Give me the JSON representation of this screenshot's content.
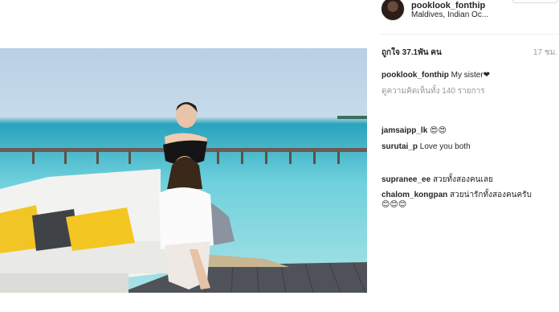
{
  "post": {
    "username": "pooklook_fonthip",
    "location": "Maldives, Indian Oc...",
    "likes": "ถูกใจ 37.1พัน คน",
    "time": "17 ชม.",
    "caption_user": "pooklook_fonthip",
    "caption_text": "My sister❤",
    "view_all": "ดูความคิดเห็นทั้ง 140 รายการ"
  },
  "comments": [
    {
      "user": "jamsaipp_lk",
      "text": "😍😍"
    },
    {
      "user": "surutai_p",
      "text": "Love you both"
    },
    {
      "user": "supranee_ee",
      "text": "สวยทั้งสองคนเลย"
    },
    {
      "user": "chalom_kongpan",
      "text": "สวยน่ารักทั้งสองคนครับ"
    },
    {
      "user": "",
      "text": "😊😊😊"
    }
  ]
}
